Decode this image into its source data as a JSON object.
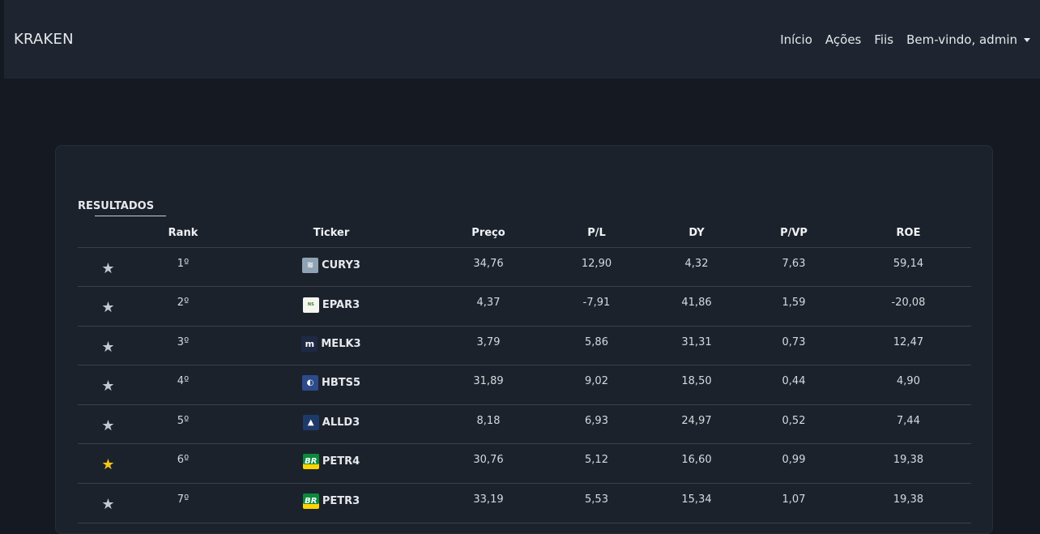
{
  "navbar": {
    "brand": "KRAKEN",
    "links": [
      "Início",
      "Ações",
      "Fiis"
    ],
    "user_menu": "Bem-vindo, admin"
  },
  "results": {
    "title": "RESULTADOS",
    "headers": [
      "Rank",
      "Ticker",
      "Preço",
      "P/L",
      "DY",
      "P/VP",
      "ROE"
    ],
    "rows": [
      {
        "favorite": false,
        "rank": "1º",
        "ticker": "CURY3",
        "logo": "cury-logo-icon",
        "preco": "34,76",
        "pl": "12,90",
        "dy": "4,32",
        "pvp": "7,63",
        "roe": "59,14"
      },
      {
        "favorite": false,
        "rank": "2º",
        "ticker": "EPAR3",
        "logo": "epar-logo-icon",
        "preco": "4,37",
        "pl": "-7,91",
        "dy": "41,86",
        "pvp": "1,59",
        "roe": "-20,08"
      },
      {
        "favorite": false,
        "rank": "3º",
        "ticker": "MELK3",
        "logo": "melk-logo-icon",
        "preco": "3,79",
        "pl": "5,86",
        "dy": "31,31",
        "pvp": "0,73",
        "roe": "12,47"
      },
      {
        "favorite": false,
        "rank": "4º",
        "ticker": "HBTS5",
        "logo": "hbts-logo-icon",
        "preco": "31,89",
        "pl": "9,02",
        "dy": "18,50",
        "pvp": "0,44",
        "roe": "4,90"
      },
      {
        "favorite": false,
        "rank": "5º",
        "ticker": "ALLD3",
        "logo": "alld-logo-icon",
        "preco": "8,18",
        "pl": "6,93",
        "dy": "24,97",
        "pvp": "0,52",
        "roe": "7,44"
      },
      {
        "favorite": true,
        "rank": "6º",
        "ticker": "PETR4",
        "logo": "petrobras-logo-icon",
        "preco": "30,76",
        "pl": "5,12",
        "dy": "16,60",
        "pvp": "0,99",
        "roe": "19,38"
      },
      {
        "favorite": false,
        "rank": "7º",
        "ticker": "PETR3",
        "logo": "petrobras-logo-icon",
        "preco": "33,19",
        "pl": "5,53",
        "dy": "15,34",
        "pvp": "1,07",
        "roe": "19,38"
      }
    ]
  },
  "icons": {
    "star": "star-icon",
    "star_color_default": "#c5c8ce",
    "star_color_favorite": "#f5c518"
  }
}
